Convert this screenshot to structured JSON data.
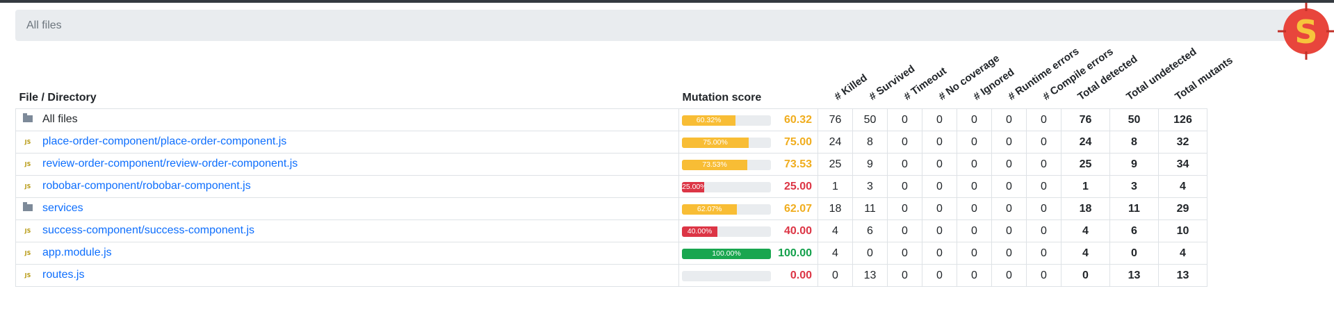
{
  "breadcrumb": {
    "label": "All files"
  },
  "logo": {
    "letter": "S",
    "bg": "#e8453c",
    "fg": "#f7c43c"
  },
  "table": {
    "headers": {
      "file": "File / Directory",
      "score": "Mutation score",
      "metrics": [
        "# Killed",
        "# Survived",
        "# Timeout",
        "# No coverage",
        "# Ignored",
        "# Runtime errors",
        "# Compile errors",
        "Total detected",
        "Total undetected",
        "Total mutants"
      ]
    },
    "rows": [
      {
        "icon": "folder-icon",
        "name": "All files",
        "link": false,
        "score": 60.32,
        "bar_label": "60.32%",
        "score_text": "60.32",
        "status": "warn",
        "killed": "76",
        "survived": "50",
        "timeout": "0",
        "no_coverage": "0",
        "ignored": "0",
        "runtime": "0",
        "compile": "0",
        "detected": "76",
        "undetected": "50",
        "total": "126"
      },
      {
        "icon": "js-icon",
        "name": "place-order-component/place-order-component.js",
        "link": true,
        "score": 75.0,
        "bar_label": "75.00%",
        "score_text": "75.00",
        "status": "warn",
        "killed": "24",
        "survived": "8",
        "timeout": "0",
        "no_coverage": "0",
        "ignored": "0",
        "runtime": "0",
        "compile": "0",
        "detected": "24",
        "undetected": "8",
        "total": "32"
      },
      {
        "icon": "js-icon",
        "name": "review-order-component/review-order-component.js",
        "link": true,
        "score": 73.53,
        "bar_label": "73.53%",
        "score_text": "73.53",
        "status": "warn",
        "killed": "25",
        "survived": "9",
        "timeout": "0",
        "no_coverage": "0",
        "ignored": "0",
        "runtime": "0",
        "compile": "0",
        "detected": "25",
        "undetected": "9",
        "total": "34"
      },
      {
        "icon": "js-icon",
        "name": "robobar-component/robobar-component.js",
        "link": true,
        "score": 25.0,
        "bar_label": "25.00%",
        "score_text": "25.00",
        "status": "danger",
        "killed": "1",
        "survived": "3",
        "timeout": "0",
        "no_coverage": "0",
        "ignored": "0",
        "runtime": "0",
        "compile": "0",
        "detected": "1",
        "undetected": "3",
        "total": "4"
      },
      {
        "icon": "folder-icon",
        "name": "services",
        "link": true,
        "score": 62.07,
        "bar_label": "62.07%",
        "score_text": "62.07",
        "status": "warn",
        "killed": "18",
        "survived": "11",
        "timeout": "0",
        "no_coverage": "0",
        "ignored": "0",
        "runtime": "0",
        "compile": "0",
        "detected": "18",
        "undetected": "11",
        "total": "29"
      },
      {
        "icon": "js-icon",
        "name": "success-component/success-component.js",
        "link": true,
        "score": 40.0,
        "bar_label": "40.00%",
        "score_text": "40.00",
        "status": "danger",
        "killed": "4",
        "survived": "6",
        "timeout": "0",
        "no_coverage": "0",
        "ignored": "0",
        "runtime": "0",
        "compile": "0",
        "detected": "4",
        "undetected": "6",
        "total": "10"
      },
      {
        "icon": "js-icon",
        "name": "app.module.js",
        "link": true,
        "score": 100.0,
        "bar_label": "100.00%",
        "score_text": "100.00",
        "status": "success",
        "killed": "4",
        "survived": "0",
        "timeout": "0",
        "no_coverage": "0",
        "ignored": "0",
        "runtime": "0",
        "compile": "0",
        "detected": "4",
        "undetected": "0",
        "total": "4"
      },
      {
        "icon": "js-icon",
        "name": "routes.js",
        "link": true,
        "score": 0.0,
        "bar_label": "",
        "score_text": "0.00",
        "status": "danger",
        "killed": "0",
        "survived": "13",
        "timeout": "0",
        "no_coverage": "0",
        "ignored": "0",
        "runtime": "0",
        "compile": "0",
        "detected": "0",
        "undetected": "13",
        "total": "13"
      }
    ]
  }
}
